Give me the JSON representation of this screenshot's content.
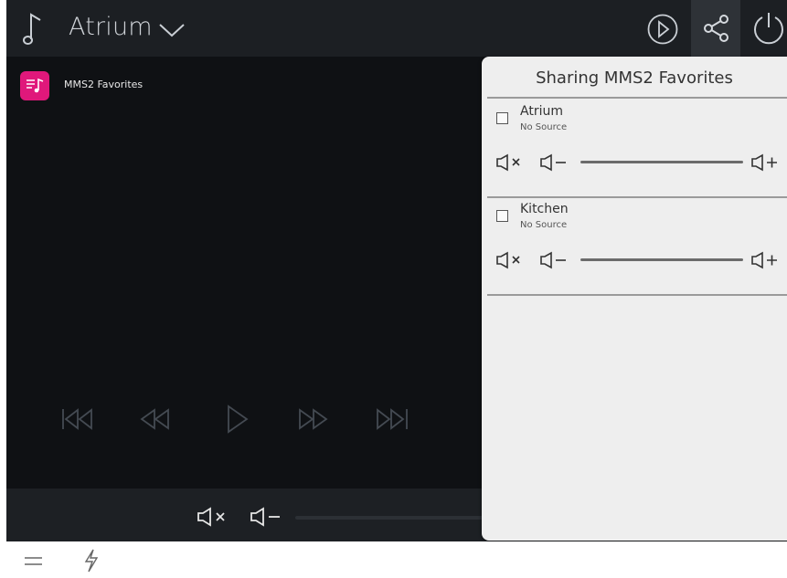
{
  "header": {
    "zone_name": "Atrium",
    "icons": [
      "music-note-icon",
      "chevron-down-icon",
      "play-circle-icon",
      "share-icon",
      "power-icon"
    ]
  },
  "source": {
    "label": "MMS2 Favorites",
    "icon": "music-source-icon",
    "color": "#e0187b"
  },
  "transport": {
    "icons": [
      "skip-previous-icon",
      "rewind-icon",
      "play-icon",
      "fast-forward-icon",
      "skip-next-icon"
    ]
  },
  "share_panel": {
    "title": "Sharing MMS2 Favorites",
    "zones": [
      {
        "name": "Atrium",
        "status": "No Source",
        "checked": false
      },
      {
        "name": "Kitchen",
        "status": "No Source",
        "checked": false
      }
    ]
  },
  "footer": {
    "icons": [
      "menu-icon",
      "lightning-icon"
    ]
  },
  "colors": {
    "topbar": "#1c1f23",
    "main": "#0f1114",
    "panel": "#eeeeee",
    "accent": "#e0187b"
  }
}
